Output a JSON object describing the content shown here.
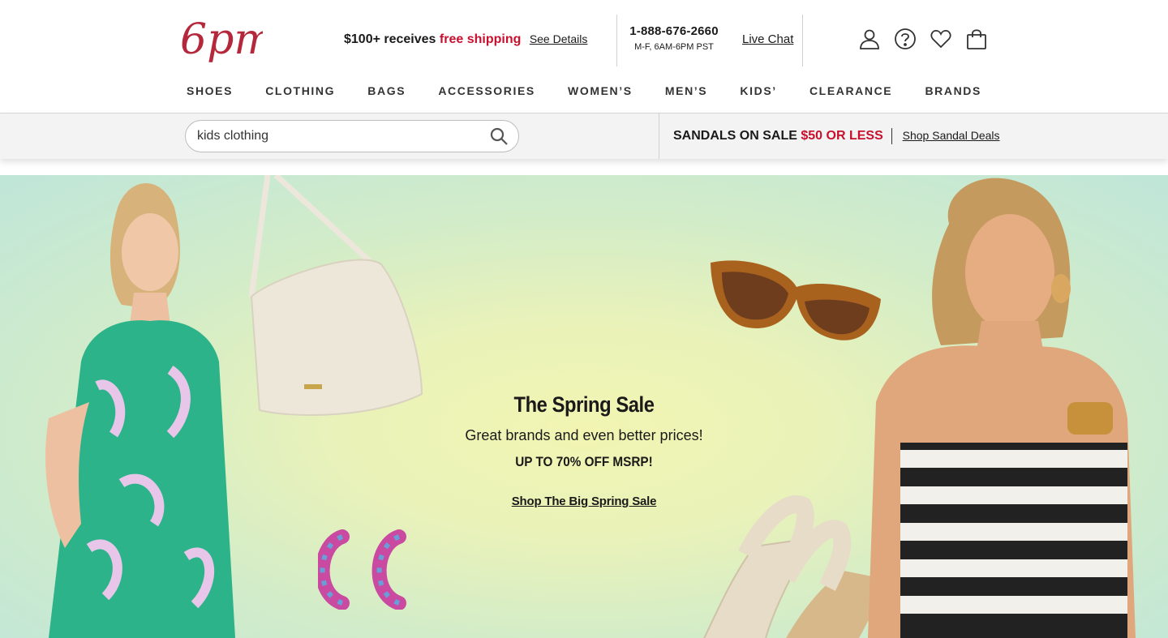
{
  "header": {
    "logo_text": "6pm",
    "shipping": {
      "prefix": "$100+ receives",
      "highlight": "free shipping",
      "link": "See Details"
    },
    "phone": {
      "number": "1-888-676-2660",
      "hours": "M-F, 6AM-6PM PST"
    },
    "live_chat": "Live Chat",
    "icons": [
      "account-icon",
      "help-icon",
      "favorites-icon",
      "cart-icon"
    ],
    "brand_color": "#c8102e"
  },
  "nav": {
    "items": [
      "SHOES",
      "CLOTHING",
      "BAGS",
      "ACCESSORIES",
      "WOMEN’S",
      "MEN’S",
      "KIDS’",
      "CLEARANCE",
      "BRANDS"
    ]
  },
  "search": {
    "value": "kids clothing"
  },
  "promo": {
    "prefix": "SANDALS ON SALE",
    "highlight": "$50 OR LESS",
    "link": "Shop Sandal Deals"
  },
  "hero": {
    "title": "The Spring Sale",
    "subtitle": "Great brands and even better prices!",
    "offer": "UP TO 70% OFF MSRP!",
    "cta": "Shop The Big Spring Sale"
  }
}
